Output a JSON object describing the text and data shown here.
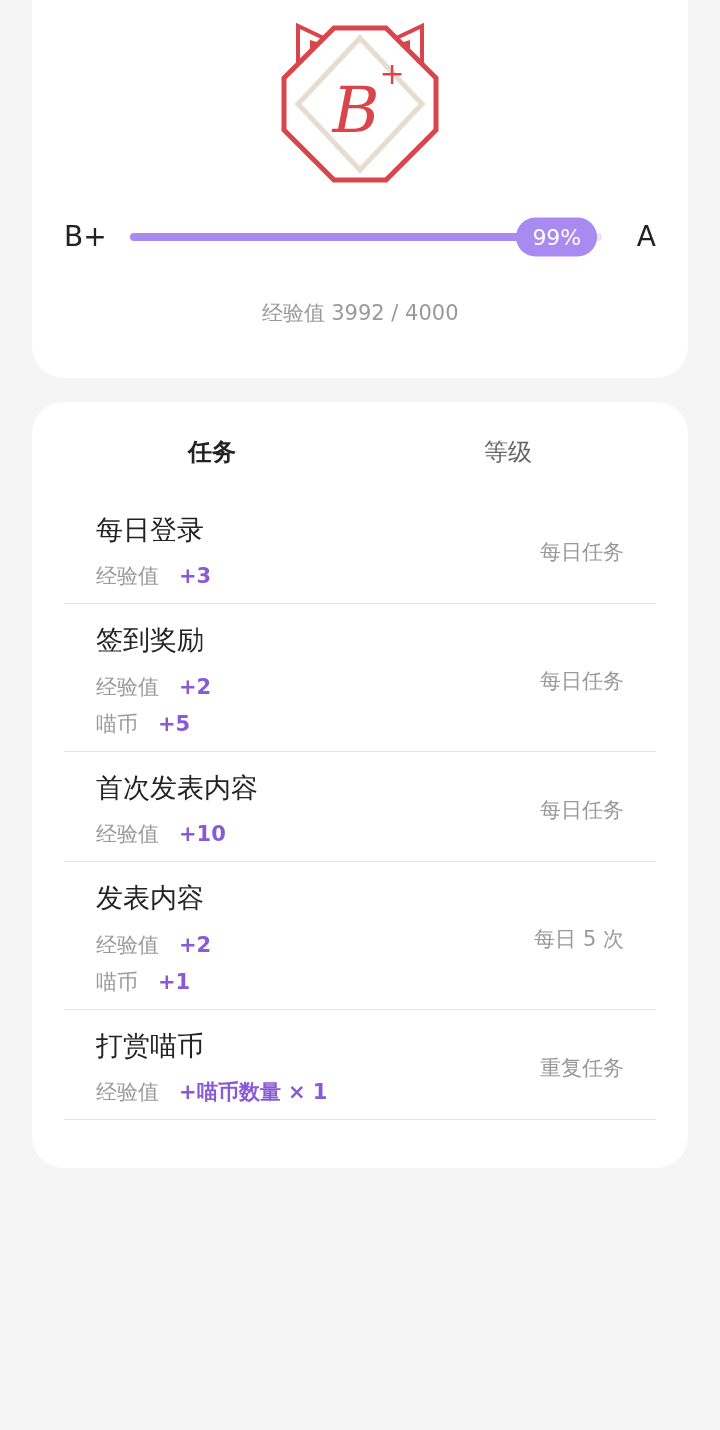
{
  "badge": {
    "grade": "B+"
  },
  "progress": {
    "from": "B+",
    "to": "A",
    "level": 0.99,
    "percent": "99%",
    "caption": "经验值 3992 / 4000"
  },
  "tabs": [
    {
      "label": "任务",
      "selected": true
    },
    {
      "label": "等级",
      "selected": false
    }
  ],
  "tasks": [
    {
      "title": "每日登录",
      "rewards": [
        {
          "label": "经验值",
          "value": "+3"
        }
      ],
      "frequency": "每日任务"
    },
    {
      "title": "签到奖励",
      "rewards": [
        {
          "label": "经验值",
          "value": "+2"
        },
        {
          "label": "喵币",
          "value": "+5"
        }
      ],
      "frequency": "每日任务"
    },
    {
      "title": "首次发表内容",
      "rewards": [
        {
          "label": "经验值",
          "value": "+10"
        }
      ],
      "frequency": "每日任务"
    },
    {
      "title": "发表内容",
      "rewards": [
        {
          "label": "经验值",
          "value": "+2"
        },
        {
          "label": "喵币",
          "value": "+1"
        }
      ],
      "frequency": "每日 5 次"
    },
    {
      "title": "打赏喵币",
      "rewards": [
        {
          "label": "经验值",
          "value": "+喵币数量 × 1"
        }
      ],
      "frequency": "重复任务"
    }
  ]
}
